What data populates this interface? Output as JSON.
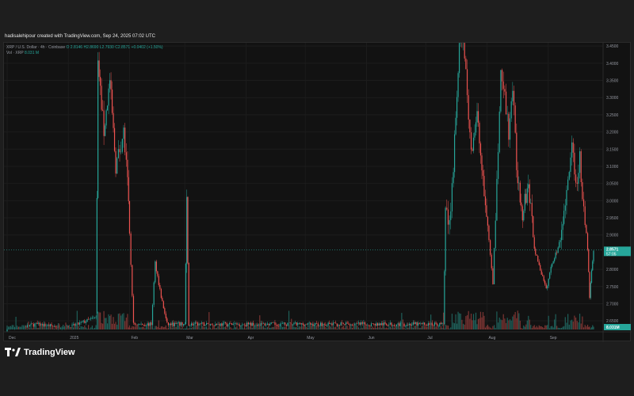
{
  "header": {
    "text": "hadisalehipour created with TradingView.com, Sep 24, 2025 07:02 UTC"
  },
  "legend": {
    "symbol": "XRP / U.S. Dollar · 4h · Coinbase",
    "open": "O 2.8146",
    "high": "H2.8690",
    "low": "L2.7930",
    "close": "C2.8571",
    "change": "+0.0402 (+1.50%)",
    "volume_label": "Vol · XRP",
    "volume_value": "8.031 M"
  },
  "footer": {
    "brand": "TradingView"
  },
  "colors": {
    "up": "#26a69a",
    "down": "#ef5350",
    "background": "#121212",
    "last_price_line": "#26a69a"
  },
  "chart_data": {
    "type": "candlestick",
    "price_axis": {
      "ticks": [
        3.45,
        3.4,
        3.35,
        3.3,
        3.25,
        3.2,
        3.15,
        3.1,
        3.05,
        3.0,
        2.95,
        2.9,
        2.8,
        2.75,
        2.7,
        2.65
      ],
      "tick_labels": [
        "3.4500",
        "3.4000",
        "3.3500",
        "3.3000",
        "3.2500",
        "3.2000",
        "3.1500",
        "3.1000",
        "3.0500",
        "3.0000",
        "2.9500",
        "2.9000",
        "2.8000",
        "2.7500",
        "2.7000",
        "2.6500"
      ],
      "ylim": [
        2.625,
        3.455
      ]
    },
    "time_axis": {
      "labels": [
        "Dec",
        "2025",
        "Feb",
        "Mar",
        "Apr",
        "May",
        "Jun",
        "Jul",
        "Aug",
        "Sep"
      ],
      "range": [
        "2024-12-01",
        "2025-09-24"
      ]
    },
    "last_price": {
      "value": "2.8571",
      "countdown": "57:05"
    },
    "volume_last": "8.031M",
    "series_path": [
      {
        "date": "2024-12-01",
        "price": 2.62
      },
      {
        "date": "2024-12-15",
        "price": 2.64
      },
      {
        "date": "2025-01-01",
        "price": 2.63
      },
      {
        "date": "2025-01-15",
        "price": 2.66
      },
      {
        "date": "2025-01-16",
        "price": 3.4
      },
      {
        "date": "2025-01-19",
        "price": 3.2
      },
      {
        "date": "2025-01-22",
        "price": 3.35
      },
      {
        "date": "2025-01-25",
        "price": 3.1
      },
      {
        "date": "2025-01-29",
        "price": 3.2
      },
      {
        "date": "2025-01-31",
        "price": 3.05
      },
      {
        "date": "2025-02-01",
        "price": 2.9
      },
      {
        "date": "2025-02-03",
        "price": 2.64
      },
      {
        "date": "2025-02-12",
        "price": 2.64
      },
      {
        "date": "2025-02-14",
        "price": 2.82
      },
      {
        "date": "2025-02-17",
        "price": 2.72
      },
      {
        "date": "2025-02-20",
        "price": 2.64
      },
      {
        "date": "2025-03-01",
        "price": 2.64
      },
      {
        "date": "2025-03-02",
        "price": 2.99
      },
      {
        "date": "2025-03-03",
        "price": 2.64
      },
      {
        "date": "2025-07-10",
        "price": 2.64
      },
      {
        "date": "2025-07-11",
        "price": 2.96
      },
      {
        "date": "2025-07-13",
        "price": 2.93
      },
      {
        "date": "2025-07-15",
        "price": 3.1
      },
      {
        "date": "2025-07-18",
        "price": 3.45
      },
      {
        "date": "2025-07-20",
        "price": 3.5
      },
      {
        "date": "2025-07-22",
        "price": 3.3
      },
      {
        "date": "2025-07-24",
        "price": 3.15
      },
      {
        "date": "2025-07-27",
        "price": 3.25
      },
      {
        "date": "2025-07-30",
        "price": 3.05
      },
      {
        "date": "2025-08-02",
        "price": 2.88
      },
      {
        "date": "2025-08-04",
        "price": 2.76
      },
      {
        "date": "2025-08-06",
        "price": 3.05
      },
      {
        "date": "2025-08-08",
        "price": 3.37
      },
      {
        "date": "2025-08-10",
        "price": 3.3
      },
      {
        "date": "2025-08-12",
        "price": 3.2
      },
      {
        "date": "2025-08-14",
        "price": 3.33
      },
      {
        "date": "2025-08-16",
        "price": 3.1
      },
      {
        "date": "2025-08-19",
        "price": 2.96
      },
      {
        "date": "2025-08-22",
        "price": 3.05
      },
      {
        "date": "2025-08-25",
        "price": 2.86
      },
      {
        "date": "2025-08-28",
        "price": 2.8
      },
      {
        "date": "2025-08-31",
        "price": 2.74
      },
      {
        "date": "2025-09-03",
        "price": 2.82
      },
      {
        "date": "2025-09-06",
        "price": 2.86
      },
      {
        "date": "2025-09-09",
        "price": 2.98
      },
      {
        "date": "2025-09-11",
        "price": 3.05
      },
      {
        "date": "2025-09-13",
        "price": 3.18
      },
      {
        "date": "2025-09-15",
        "price": 3.05
      },
      {
        "date": "2025-09-17",
        "price": 3.12
      },
      {
        "date": "2025-09-19",
        "price": 2.98
      },
      {
        "date": "2025-09-21",
        "price": 2.86
      },
      {
        "date": "2025-09-22",
        "price": 2.72
      },
      {
        "date": "2025-09-23",
        "price": 2.8
      },
      {
        "date": "2025-09-24",
        "price": 2.8571
      }
    ]
  }
}
